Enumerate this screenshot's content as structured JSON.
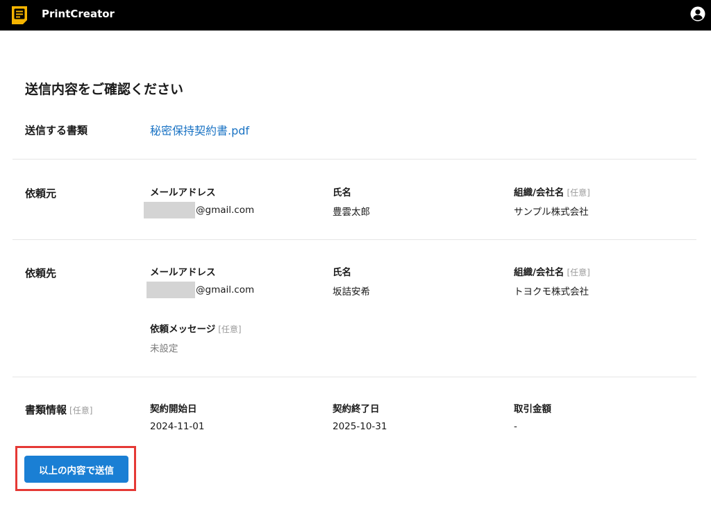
{
  "app": {
    "title": "PrintCreator"
  },
  "colors": {
    "topbar": "#000000",
    "accent": "#1a7fd4",
    "link": "#1a73c4",
    "highlight": "#e53935",
    "logo": "#f5b400"
  },
  "icons": {
    "logo": "document-icon",
    "user": "user-account-icon"
  },
  "page": {
    "title": "送信内容をご確認ください"
  },
  "document": {
    "label": "送信する書類",
    "file_name": "秘密保持契約書.pdf"
  },
  "requester": {
    "label": "依頼元",
    "email_label": "メールアドレス",
    "email_domain": "@gmail.com",
    "name_label": "氏名",
    "name": "豊雲太郎",
    "org_label": "組織/会社名",
    "org_optional": "[任意]",
    "org": "サンプル株式会社"
  },
  "recipient": {
    "label": "依頼先",
    "email_label": "メールアドレス",
    "email_domain": "@gmail.com",
    "name_label": "氏名",
    "name": "坂詰安希",
    "org_label": "組織/会社名",
    "org_optional": "[任意]",
    "org": "トヨクモ株式会社",
    "message_label": "依頼メッセージ",
    "message_optional": "[任意]",
    "message": "未設定"
  },
  "doc_info": {
    "label": "書類情報",
    "optional": "[任意]",
    "start_label": "契約開始日",
    "start_date": "2024-11-01",
    "end_label": "契約終了日",
    "end_date": "2025-10-31",
    "amount_label": "取引金額",
    "amount": "-"
  },
  "actions": {
    "submit_label": "以上の内容で送信"
  }
}
